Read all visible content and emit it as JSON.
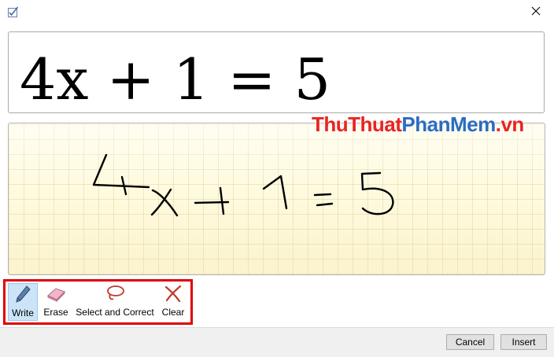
{
  "window": {
    "icon": "math-input-icon",
    "close_icon": "close-icon"
  },
  "preview": {
    "expression": "4x + 1 = 5"
  },
  "watermark": {
    "part1": "ThuThuat",
    "part2": "PhanMem",
    "part3": ".vn"
  },
  "toolbar": {
    "write": {
      "label": "Write",
      "icon": "pen-icon",
      "active": true
    },
    "erase": {
      "label": "Erase",
      "icon": "eraser-icon"
    },
    "select_correct": {
      "label": "Select and Correct",
      "icon": "lasso-icon"
    },
    "clear": {
      "label": "Clear",
      "icon": "clear-x-icon"
    }
  },
  "footer": {
    "cancel_label": "Cancel",
    "insert_label": "Insert"
  },
  "colors": {
    "highlight_box": "#e00000",
    "ink": "#000000",
    "write_area": "#fffbe0"
  }
}
